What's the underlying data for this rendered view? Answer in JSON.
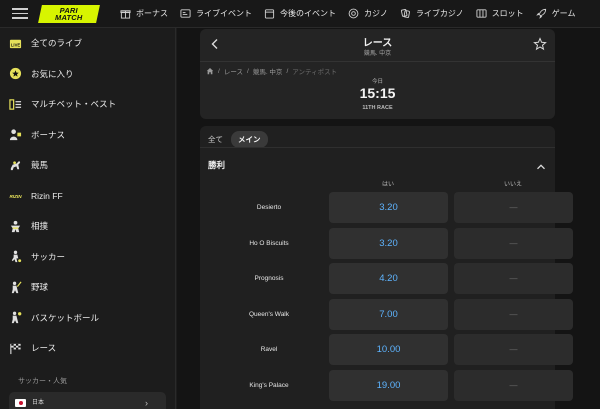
{
  "brand": {
    "logo_line1": "PARI",
    "logo_line2": "MATCH",
    "accent": "#d7f500"
  },
  "topnav": [
    {
      "label": "ボーナス",
      "icon": "gift-icon"
    },
    {
      "label": "ライブイベント",
      "icon": "live-screen-icon"
    },
    {
      "label": "今後のイベント",
      "icon": "calendar-icon"
    },
    {
      "label": "カジノ",
      "icon": "casino-chip-icon"
    },
    {
      "label": "ライブカジノ",
      "icon": "live-casino-icon"
    },
    {
      "label": "スロット",
      "icon": "slot-icon"
    },
    {
      "label": "ゲーム",
      "icon": "rocket-icon"
    }
  ],
  "sidebar": {
    "items": [
      {
        "label": "全てのライブ",
        "icon": "live-icon"
      },
      {
        "label": "お気に入り",
        "icon": "star-icon"
      },
      {
        "label": "マルチベット・ベスト",
        "icon": "multibet-icon"
      },
      {
        "label": "ボーナス",
        "icon": "bonus-icon"
      },
      {
        "label": "競馬",
        "icon": "horse-racing-icon"
      },
      {
        "label": "Rizin FF",
        "icon": "rizin-icon"
      },
      {
        "label": "相撲",
        "icon": "sumo-icon"
      },
      {
        "label": "サッカー",
        "icon": "soccer-icon"
      },
      {
        "label": "野球",
        "icon": "baseball-icon"
      },
      {
        "label": "バスケットボール",
        "icon": "basketball-icon"
      },
      {
        "label": "レース",
        "icon": "racing-flag-icon"
      }
    ],
    "section_title": "サッカー・人気",
    "card": {
      "country": "日本"
    }
  },
  "event": {
    "title": "レース",
    "subtitle": "競馬. 中京",
    "breadcrumb": [
      "レース",
      "競馬. 中京",
      "アンティポスト"
    ],
    "today_label": "今日",
    "time": "15:15",
    "race": "11TH RACE"
  },
  "market": {
    "tabs": [
      {
        "label": "全て",
        "active": false
      },
      {
        "label": "メイン",
        "active": true
      }
    ],
    "title": "勝利",
    "col_yes": "はい",
    "col_no": "いいえ",
    "rows": [
      {
        "runner": "Desierto",
        "yes": "3.20",
        "no": "—"
      },
      {
        "runner": "Ho O Biscuits",
        "yes": "3.20",
        "no": "—"
      },
      {
        "runner": "Prognosis",
        "yes": "4.20",
        "no": "—"
      },
      {
        "runner": "Queen's Walk",
        "yes": "7.00",
        "no": "—"
      },
      {
        "runner": "Ravel",
        "yes": "10.00",
        "no": "—"
      },
      {
        "runner": "King's Palace",
        "yes": "19.00",
        "no": "—"
      }
    ]
  },
  "colors": {
    "odds_blue": "#5eb4ff",
    "background": "#141414",
    "card": "#242424"
  }
}
